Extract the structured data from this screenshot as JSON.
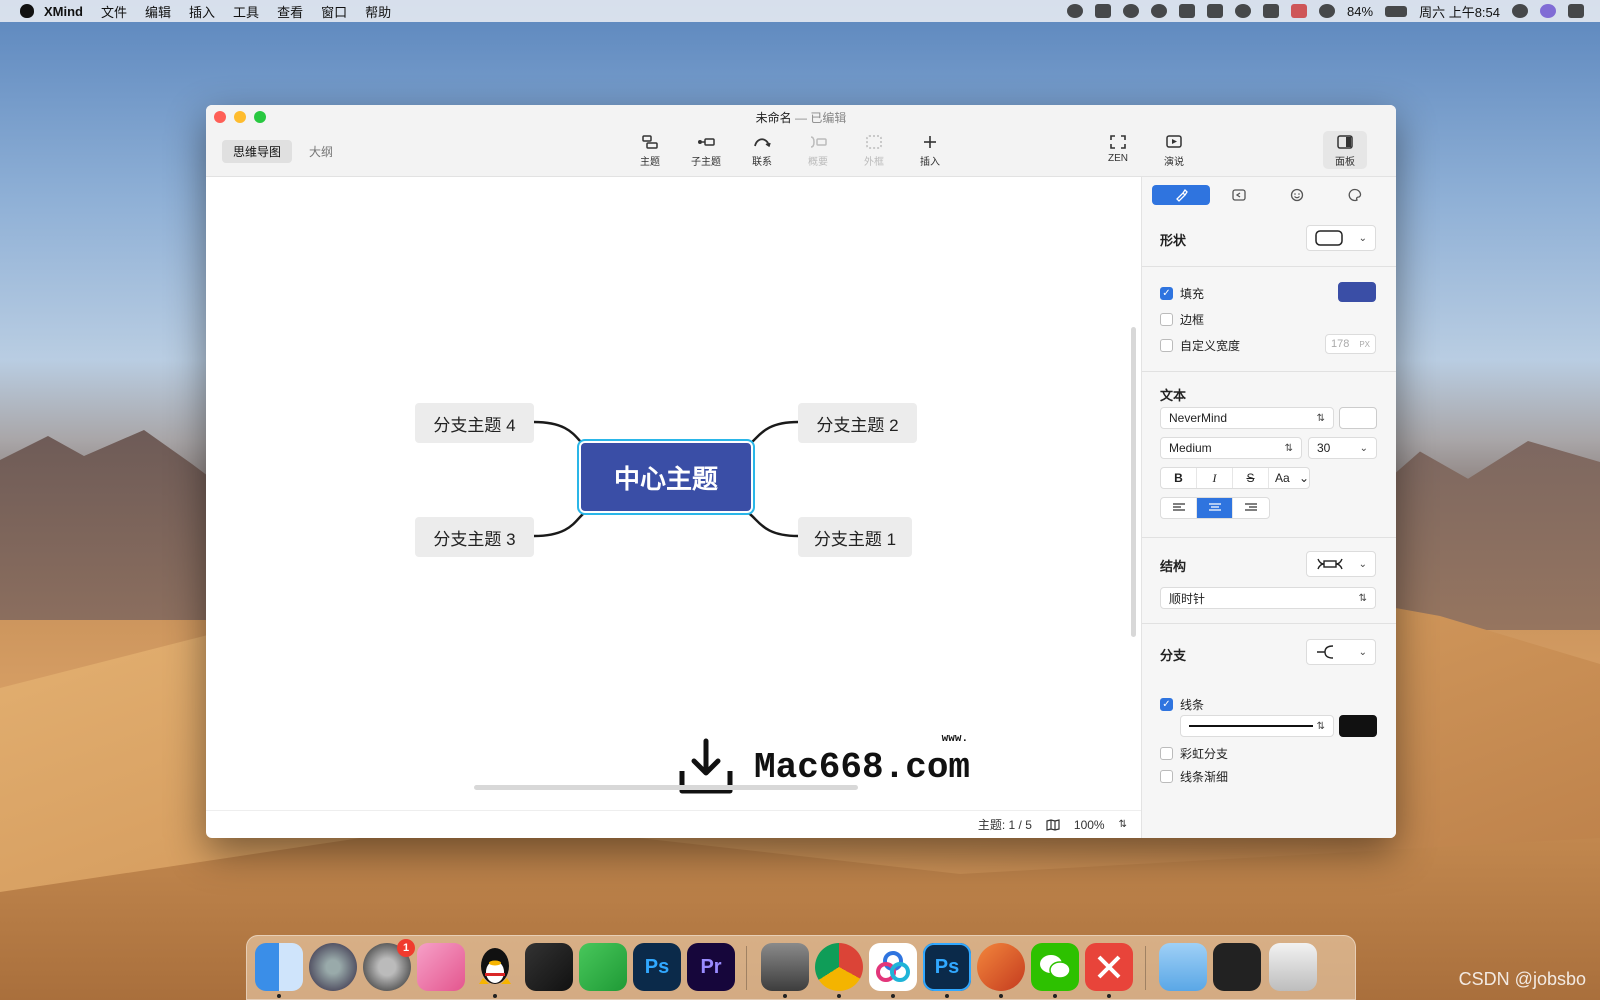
{
  "menubar": {
    "app_name": "XMind",
    "items": [
      "文件",
      "编辑",
      "插入",
      "工具",
      "查看",
      "窗口",
      "帮助"
    ],
    "battery": "84%",
    "clock": "周六 上午8:54"
  },
  "window": {
    "title": "未命名",
    "edited": "— 已编辑",
    "view_tabs": [
      "思维导图",
      "大纲"
    ],
    "toolbar": {
      "topic": "主题",
      "subtopic": "子主题",
      "relation": "联系",
      "summary": "概要",
      "boundary": "外框",
      "insert": "插入",
      "zen": "ZEN",
      "pitch": "演说",
      "panel": "面板"
    }
  },
  "mindmap": {
    "central": "中心主题",
    "branches": {
      "b1": "分支主题 1",
      "b2": "分支主题 2",
      "b3": "分支主题 3",
      "b4": "分支主题 4"
    },
    "watermark": "Mac668.com",
    "watermark_prefix": "www."
  },
  "status": {
    "topics": "主题: 1 / 5",
    "zoom": "100%"
  },
  "panel": {
    "shape_label": "形状",
    "fill_label": "填充",
    "fill_checked": true,
    "fill_color": "#3a4ea6",
    "border_label": "边框",
    "custom_width_label": "自定义宽度",
    "custom_width_value": "178",
    "custom_width_unit": "PX",
    "text_label": "文本",
    "font": "NeverMind",
    "weight": "Medium",
    "size": "30",
    "case_label": "Aa",
    "structure_label": "结构",
    "structure_value": "顺时针",
    "branch_label": "分支",
    "line_label": "线条",
    "line_checked": true,
    "line_color": "#111111",
    "rainbow_label": "彩虹分支",
    "taper_label": "线条渐细"
  },
  "dock": {
    "badge_settings": "1"
  },
  "watermark_csdn": "CSDN @jobsbo"
}
